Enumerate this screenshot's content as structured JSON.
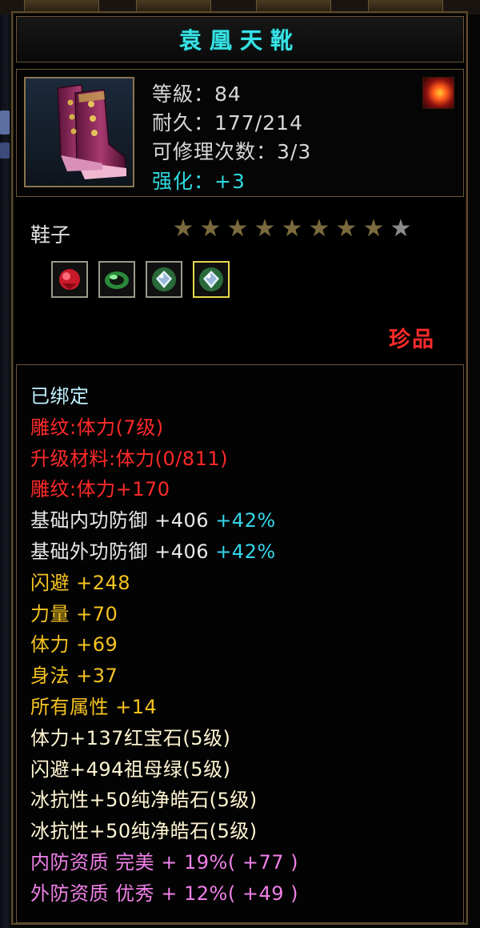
{
  "item": {
    "name": "袁凰天靴",
    "level": "等級：84",
    "durability": "耐久：177/214",
    "repair": "可修理次数：3/3",
    "enhance": "强化：+3",
    "type": "鞋子",
    "rarity": "珍品",
    "stars": {
      "filled": 8,
      "total": 9
    },
    "sockets": [
      {
        "name": "ruby-gem-icon",
        "selected": false
      },
      {
        "name": "emerald-gem-icon",
        "selected": false
      },
      {
        "name": "pure-diamond-gem-icon",
        "selected": false
      },
      {
        "name": "pure-diamond-gem-icon",
        "selected": true
      }
    ]
  },
  "properties": [
    {
      "parts": [
        {
          "t": "已绑定",
          "c": "cyan"
        }
      ]
    },
    {
      "parts": [
        {
          "t": "雕纹:体力(7级)",
          "c": "red"
        }
      ]
    },
    {
      "parts": [
        {
          "t": "升级材料:体力(0/811)",
          "c": "red"
        }
      ]
    },
    {
      "parts": [
        {
          "t": "雕纹:体力+170",
          "c": "red"
        }
      ]
    },
    {
      "parts": [
        {
          "t": "基础内功防御 +406 ",
          "c": "white"
        },
        {
          "t": "+42%",
          "c": "acc"
        }
      ]
    },
    {
      "parts": [
        {
          "t": "基础外功防御 +406 ",
          "c": "white"
        },
        {
          "t": "+42%",
          "c": "acc"
        }
      ]
    },
    {
      "parts": [
        {
          "t": "闪避 +248",
          "c": "gold"
        }
      ]
    },
    {
      "parts": [
        {
          "t": "力量 +70",
          "c": "gold"
        }
      ]
    },
    {
      "parts": [
        {
          "t": "体力 +69",
          "c": "gold"
        }
      ]
    },
    {
      "parts": [
        {
          "t": "身法 +37",
          "c": "gold"
        }
      ]
    },
    {
      "parts": [
        {
          "t": "所有属性 +14",
          "c": "gold"
        }
      ]
    },
    {
      "parts": [
        {
          "t": "体力+137红宝石(5级)",
          "c": "pale"
        }
      ]
    },
    {
      "parts": [
        {
          "t": "闪避+494祖母绿(5级)",
          "c": "pale"
        }
      ]
    },
    {
      "parts": [
        {
          "t": "冰抗性+50纯净皓石(5级)",
          "c": "pale"
        }
      ]
    },
    {
      "parts": [
        {
          "t": "冰抗性+50纯净皓石(5级)",
          "c": "pale"
        }
      ]
    },
    {
      "parts": [
        {
          "t": "内防资质 完美 + 19%( +77 )",
          "c": "pink"
        }
      ]
    },
    {
      "parts": [
        {
          "t": "外防资质 优秀 + 12%( +49 )",
          "c": "pink"
        }
      ]
    }
  ],
  "colors": {
    "cyan": "#bff0ff",
    "red": "#ff2a2a",
    "white": "#e8e8e8",
    "acc": "#34d6ea",
    "gold": "#f5c320",
    "pale": "#fff5d2",
    "pink": "#f080e8",
    "title": "#38e3e6",
    "border": "#6a5636"
  }
}
